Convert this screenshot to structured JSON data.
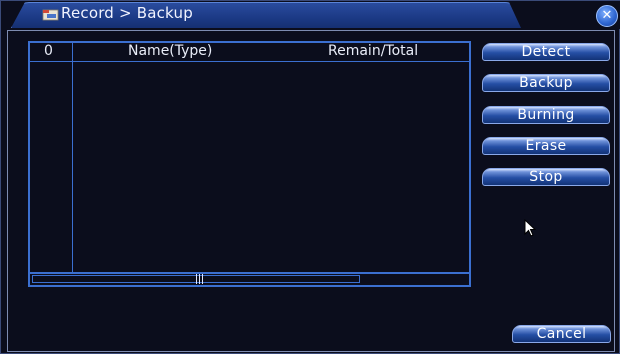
{
  "window": {
    "title": "Record > Backup",
    "close_glyph": "✕"
  },
  "table": {
    "columns": [
      "0",
      "Name(Type)",
      "Remain/Total"
    ],
    "rows": []
  },
  "actions": {
    "detect": "Detect",
    "backup": "Backup",
    "burning": "Burning",
    "erase": "Erase",
    "stop": "Stop",
    "cancel": "Cancel"
  },
  "icons": {
    "title": "record-folder-icon",
    "close": "close-icon",
    "cursor": "mouse-cursor-icon"
  },
  "colors": {
    "accent": "#3b6fd0",
    "background": "#0b0d1c",
    "title_gradient": "#1c3a86"
  }
}
